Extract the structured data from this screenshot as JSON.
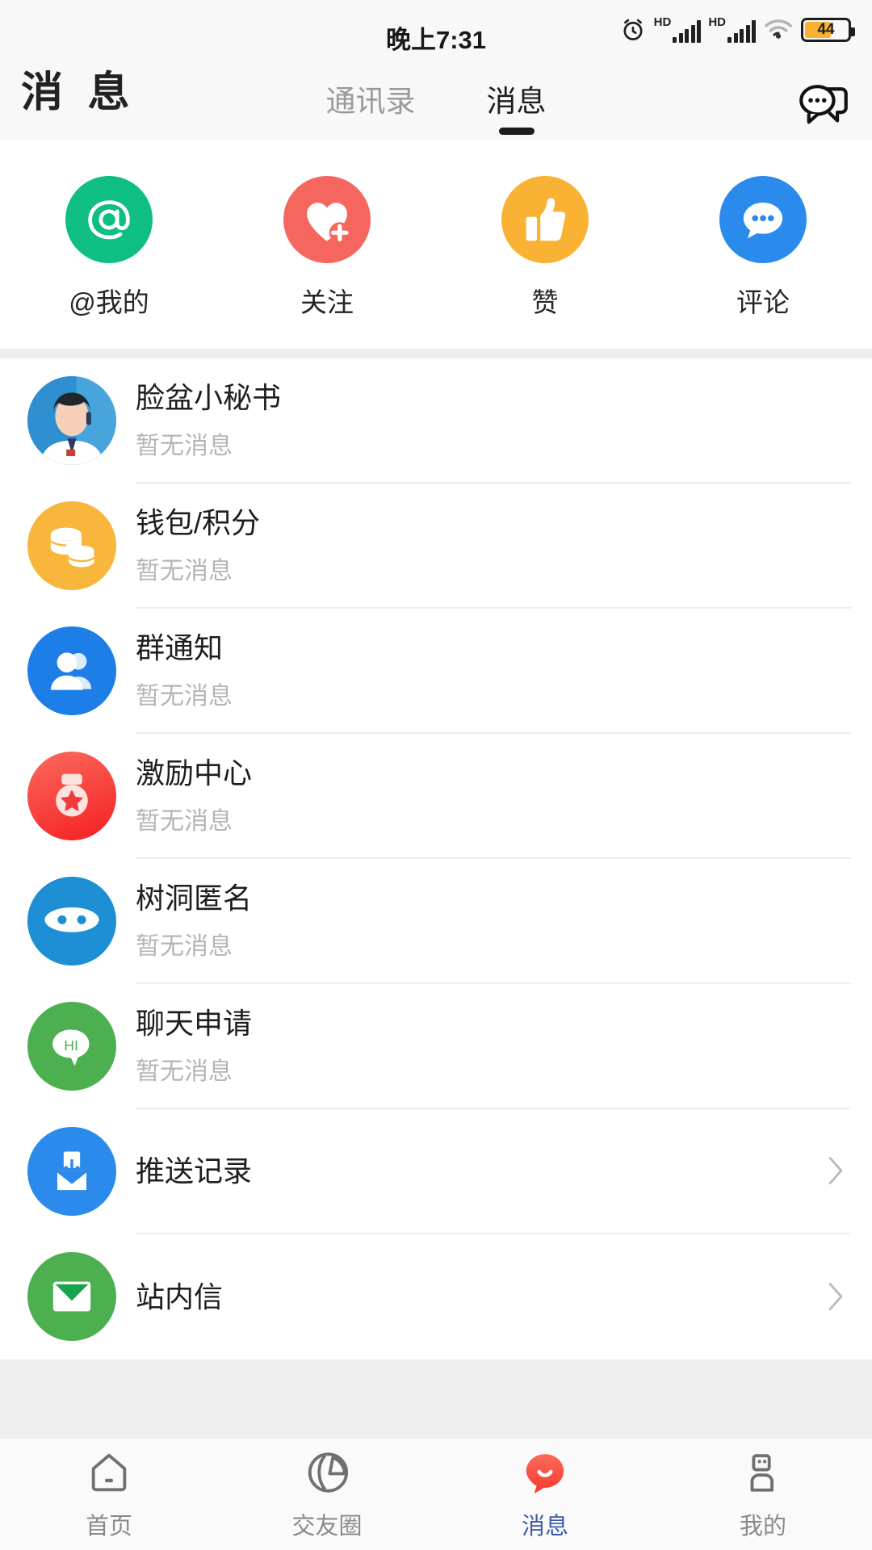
{
  "status_bar": {
    "time": "晚上7:31",
    "alarm_icon": "alarm-clock-icon",
    "sim1_label": "HD",
    "sim2_label": "HD",
    "wifi_icon": "wifi-icon",
    "battery_level": "44"
  },
  "header": {
    "brand": "消 息",
    "badge": "",
    "tabs": [
      {
        "label": "通讯录",
        "active": false
      },
      {
        "label": "消息",
        "active": true
      }
    ],
    "action_icon": "chat-bubbles-icon"
  },
  "quick_actions": [
    {
      "label": "@我的",
      "icon": "at-sign-icon",
      "color": "#0ebe83"
    },
    {
      "label": "关注",
      "icon": "heart-plus-icon",
      "color": "#f5665f"
    },
    {
      "label": "赞",
      "icon": "thumbs-up-icon",
      "color": "#f9b233"
    },
    {
      "label": "评论",
      "icon": "comment-bubble-icon",
      "color": "#2b8bec"
    }
  ],
  "message_list": [
    {
      "title": "脸盆小秘书",
      "subtitle": "暂无消息",
      "icon": "secretary-photo-avatar",
      "color": "#2f8fd0",
      "chevron": false
    },
    {
      "title": "钱包/积分",
      "subtitle": "暂无消息",
      "icon": "coins-wallet-icon",
      "color": "#f8b63c",
      "chevron": false
    },
    {
      "title": "群通知",
      "subtitle": "暂无消息",
      "icon": "group-people-icon",
      "color": "#1d7ee8",
      "chevron": false
    },
    {
      "title": "激励中心",
      "subtitle": "暂无消息",
      "icon": "medal-star-icon",
      "color": "#f53b3b",
      "chevron": false
    },
    {
      "title": "树洞匿名",
      "subtitle": "暂无消息",
      "icon": "masked-ninja-icon",
      "color": "#1e8fd5",
      "chevron": false
    },
    {
      "title": "聊天申请",
      "subtitle": "暂无消息",
      "icon": "hi-bubble-icon",
      "color": "#4caf50",
      "chevron": false
    },
    {
      "title": "推送记录",
      "subtitle": "",
      "icon": "inbox-document-icon",
      "color": "#2b8bec",
      "chevron": true
    },
    {
      "title": "站内信",
      "subtitle": "",
      "icon": "envelope-icon",
      "color": "#4caf50",
      "chevron": true
    }
  ],
  "bottom_tabs": [
    {
      "label": "首页",
      "icon": "home-icon",
      "active": false
    },
    {
      "label": "交友圈",
      "icon": "friend-circle-icon",
      "active": false
    },
    {
      "label": "消息",
      "icon": "message-bubble-icon",
      "active": true
    },
    {
      "label": "我的",
      "icon": "profile-person-icon",
      "active": false
    }
  ],
  "colors": {
    "active_tab": "#3f5ca8",
    "badge": "#f5533d",
    "accent_red": "#f5533d",
    "battery": "#f8b133"
  }
}
